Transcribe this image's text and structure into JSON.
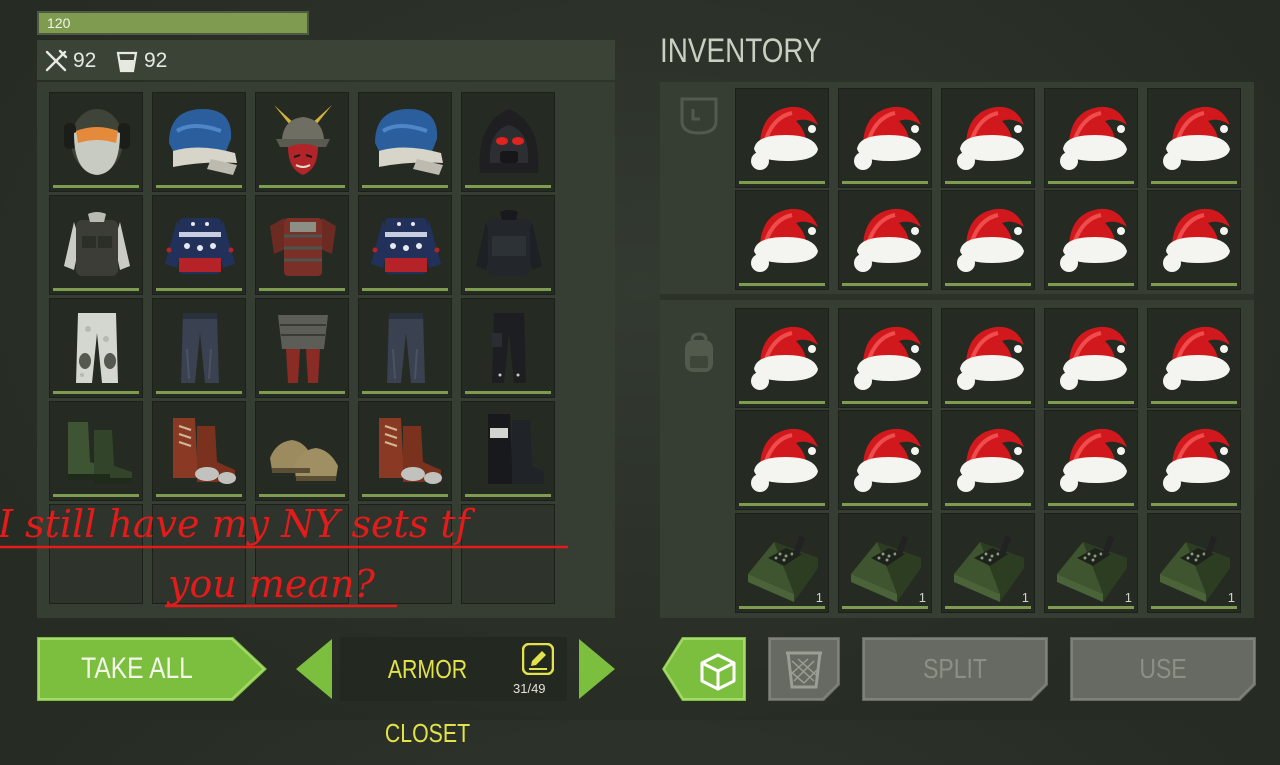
{
  "status": {
    "health_value": "120",
    "health_fraction": 1.0,
    "food_value": "92",
    "water_value": "92",
    "food_icon": "fork-knife-icon",
    "water_icon": "cup-icon"
  },
  "inventory": {
    "title": "INVENTORY",
    "pocket_icon": "pocket-icon",
    "backpack_icon": "backpack-icon",
    "rows": [
      [
        "santa-hat",
        "santa-hat",
        "santa-hat",
        "santa-hat",
        "santa-hat"
      ],
      [
        "santa-hat",
        "santa-hat",
        "santa-hat",
        "santa-hat",
        "santa-hat"
      ],
      [
        "santa-hat",
        "santa-hat",
        "santa-hat",
        "santa-hat",
        "santa-hat"
      ],
      [
        "santa-hat",
        "santa-hat",
        "santa-hat",
        "santa-hat",
        "santa-hat"
      ],
      [
        "radio-device",
        "radio-device",
        "radio-device",
        "radio-device",
        "radio-device"
      ]
    ],
    "radio_count": "1"
  },
  "closet": {
    "rows": [
      [
        "tactical-mask-helmet",
        "blue-ushanka-hat",
        "samurai-helmet",
        "blue-ushanka-hat",
        "red-eye-hood"
      ],
      [
        "armored-vest-jacket",
        "christmas-sweater",
        "samurai-armor",
        "christmas-sweater",
        "black-tactical-jacket"
      ],
      [
        "white-camo-pants",
        "dark-jeans",
        "samurai-leg-armor",
        "dark-jeans",
        "black-tactical-pants"
      ],
      [
        "green-boots",
        "brown-boots",
        "samurai-sandals",
        "brown-boots",
        "black-tactical-boots"
      ],
      [
        "empty",
        "empty",
        "empty",
        "empty",
        "empty"
      ]
    ]
  },
  "annotation": {
    "line1": "I still have my NY sets tf",
    "line2": "you mean?"
  },
  "actions": {
    "take_all": "TAKE ALL",
    "container_name": "ARMOR CLOSET",
    "capacity": "31/49",
    "split": "SPLIT",
    "use": "USE"
  },
  "colors": {
    "accent_green": "#7cbf3f",
    "slot_bg": "#252a22",
    "durability_green": "#7f9b50",
    "annotation_red": "#e41b1b",
    "container_yellow": "#e2e24a"
  }
}
